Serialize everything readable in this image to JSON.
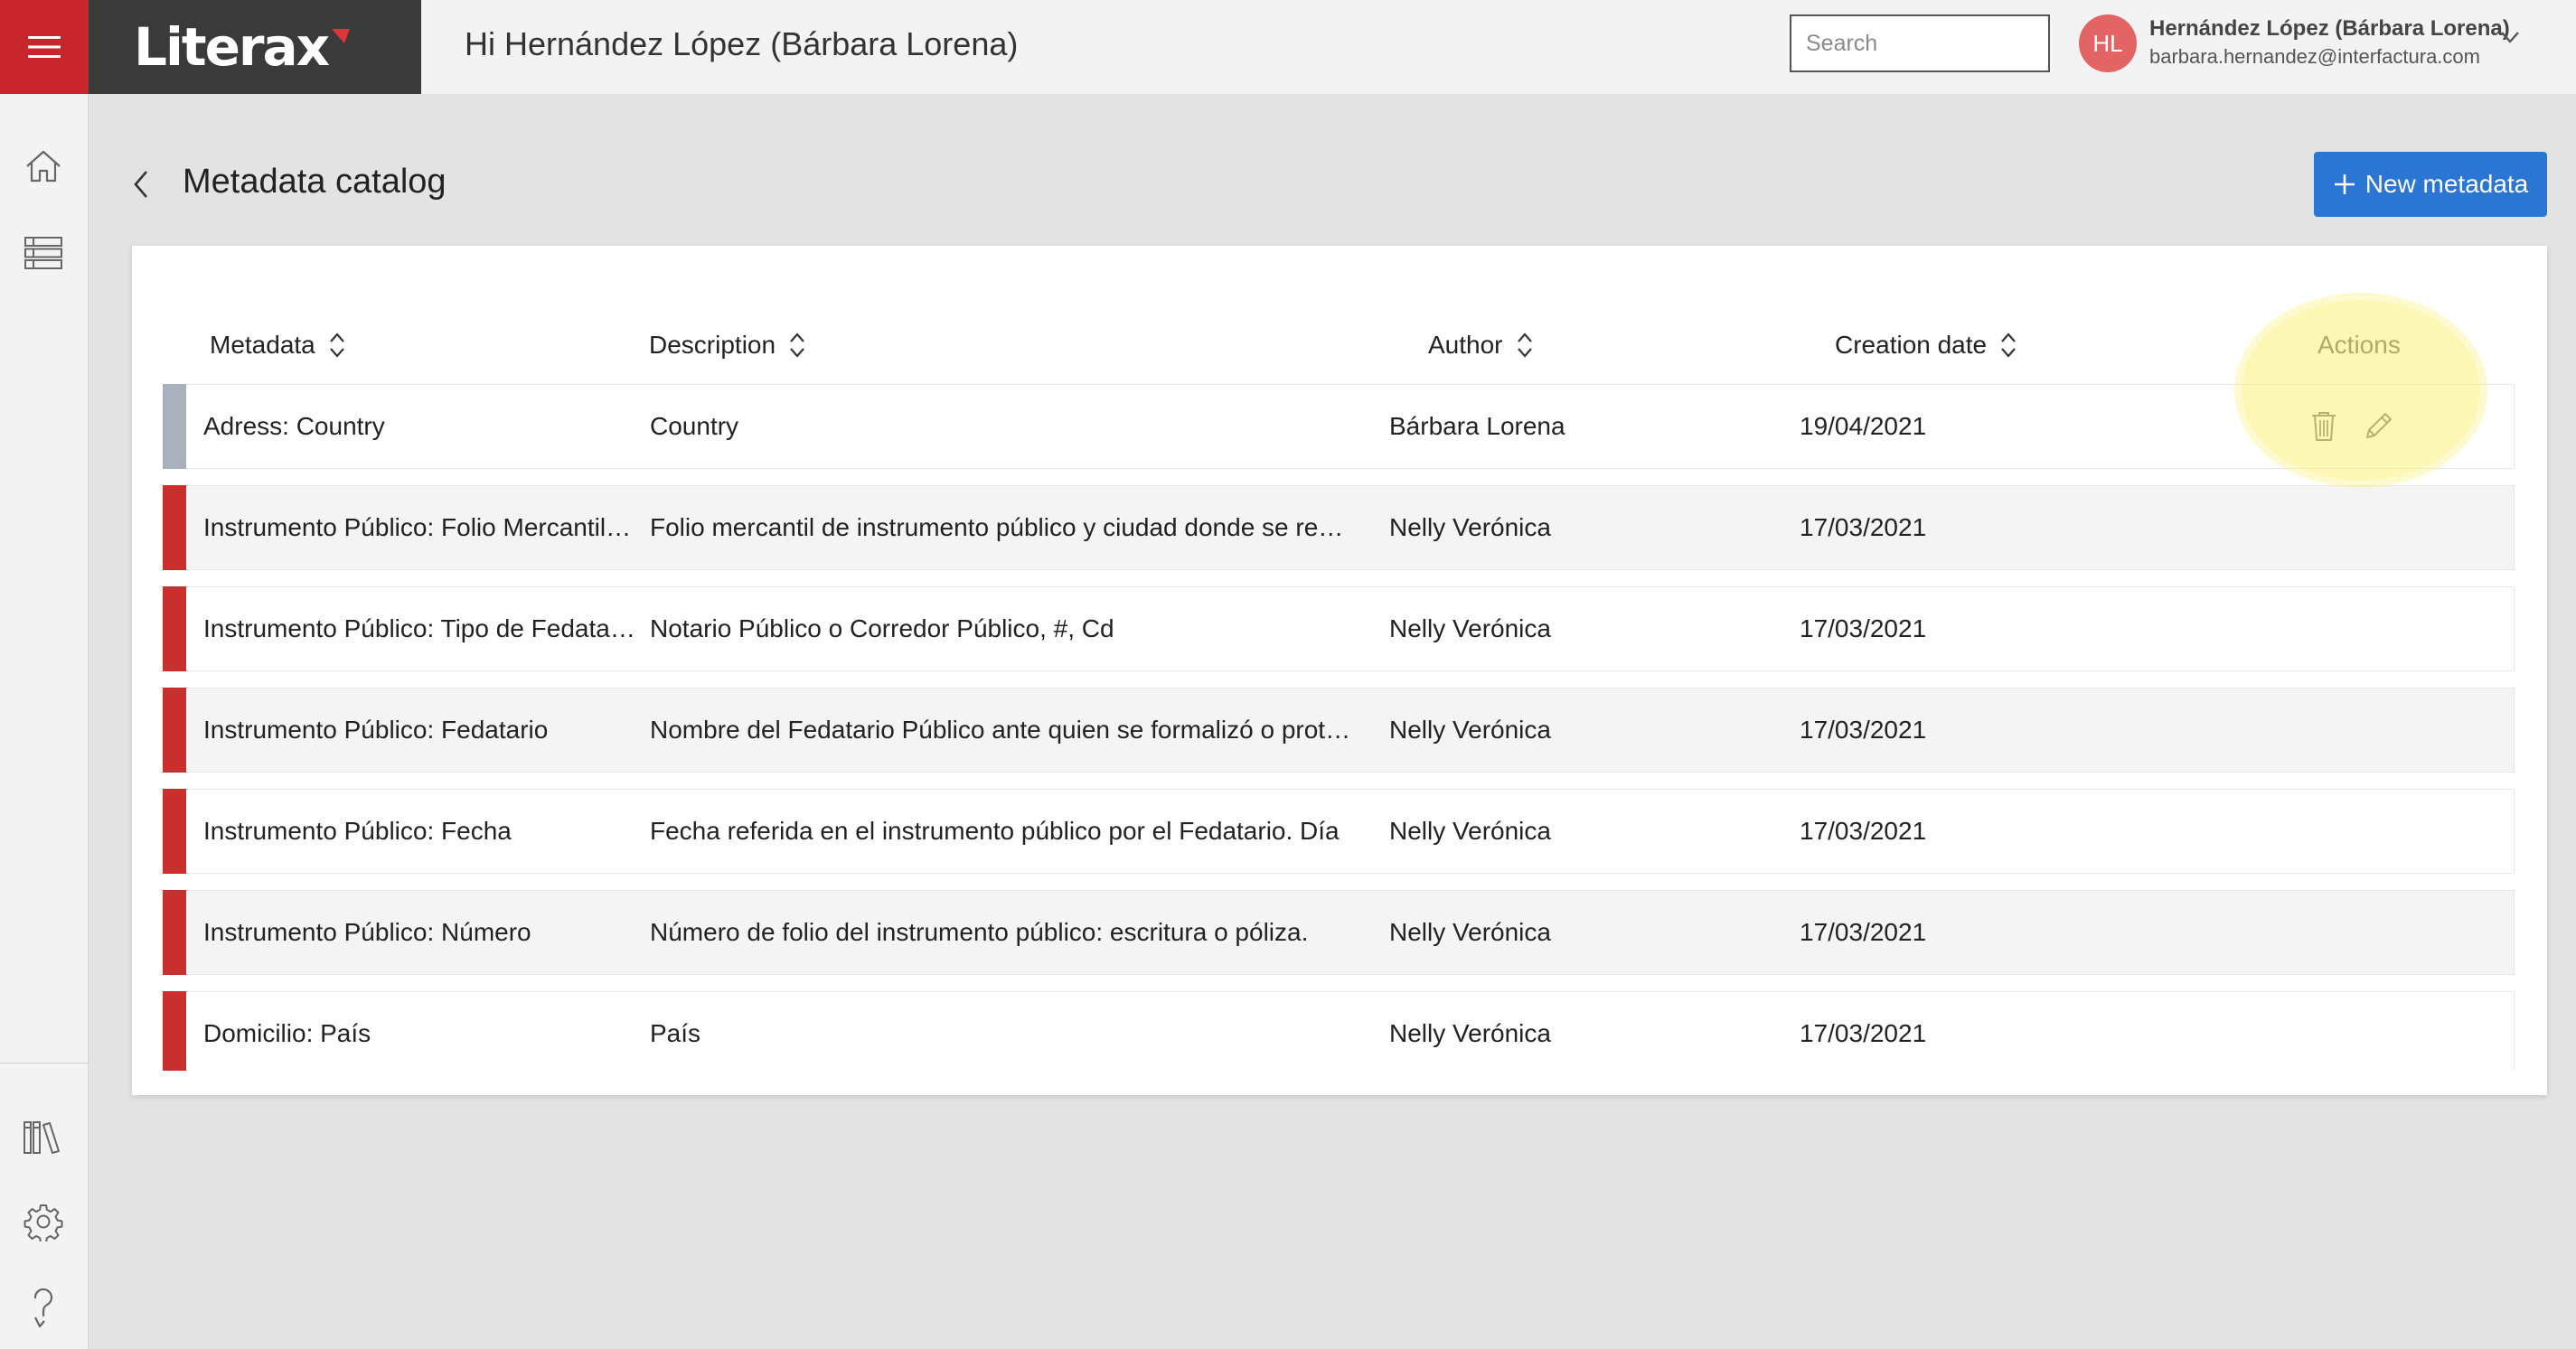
{
  "header": {
    "brand": "Literax",
    "greeting": "Hi Hernández López (Bárbara Lorena)",
    "search_placeholder": "Search",
    "avatar_initials": "HL",
    "user_name": "Hernández López (Bárbara Lorena)",
    "user_email": "barbara.hernandez@interfactura.com"
  },
  "page": {
    "title": "Metadata catalog",
    "new_button": "New metadata"
  },
  "table": {
    "columns": {
      "metadata": "Metadata",
      "description": "Description",
      "author": "Author",
      "creation_date": "Creation date",
      "actions": "Actions"
    },
    "rows": [
      {
        "metadata": "Adress: Country",
        "description": "Country",
        "author": "Bárbara Lorena",
        "date": "19/04/2021",
        "status_color": "#a9b1bd"
      },
      {
        "metadata": "Instrumento Público: Folio Mercantil, Ciudad",
        "description": "Folio mercantil de instrumento público y ciudad donde se registró",
        "author": "Nelly Verónica",
        "date": "17/03/2021",
        "status_color": "#c8302e"
      },
      {
        "metadata": "Instrumento Público: Tipo de Fedatario",
        "description": "Notario Público o Corredor Público, #, Cd",
        "author": "Nelly Verónica",
        "date": "17/03/2021",
        "status_color": "#c8302e"
      },
      {
        "metadata": "Instrumento Público: Fedatario",
        "description": "Nombre del Fedatario Público ante quien se formalizó o protocolizó",
        "author": "Nelly Verónica",
        "date": "17/03/2021",
        "status_color": "#c8302e"
      },
      {
        "metadata": "Instrumento Público: Fecha",
        "description": "Fecha referida en el instrumento público por el Fedatario. Día",
        "author": "Nelly Verónica",
        "date": "17/03/2021",
        "status_color": "#c8302e"
      },
      {
        "metadata": "Instrumento Público: Número",
        "description": "Número de folio del instrumento público: escritura o póliza.",
        "author": "Nelly Verónica",
        "date": "17/03/2021",
        "status_color": "#c8302e"
      },
      {
        "metadata": "Domicilio: País",
        "description": "País",
        "author": "Nelly Verónica",
        "date": "17/03/2021",
        "status_color": "#c8302e"
      }
    ]
  },
  "icons": {
    "menu": "hamburger-icon",
    "search": "search-icon",
    "user_menu": "chevron-down-icon",
    "home": "home-icon",
    "catalog": "layers-icon",
    "library": "books-icon",
    "settings": "gear-icon",
    "help": "help-icon",
    "back": "chevron-left-icon",
    "add": "plus-icon",
    "sort": "sort-icon",
    "delete": "trash-icon",
    "edit": "pencil-icon"
  },
  "colors": {
    "brand_red": "#c8252c",
    "brand_dark": "#3a3a3a",
    "primary": "#2b76d2",
    "row_pending": "#c8302e",
    "row_neutral": "#a9b1bd",
    "avatar": "#e36464",
    "highlight": "#faf078"
  }
}
